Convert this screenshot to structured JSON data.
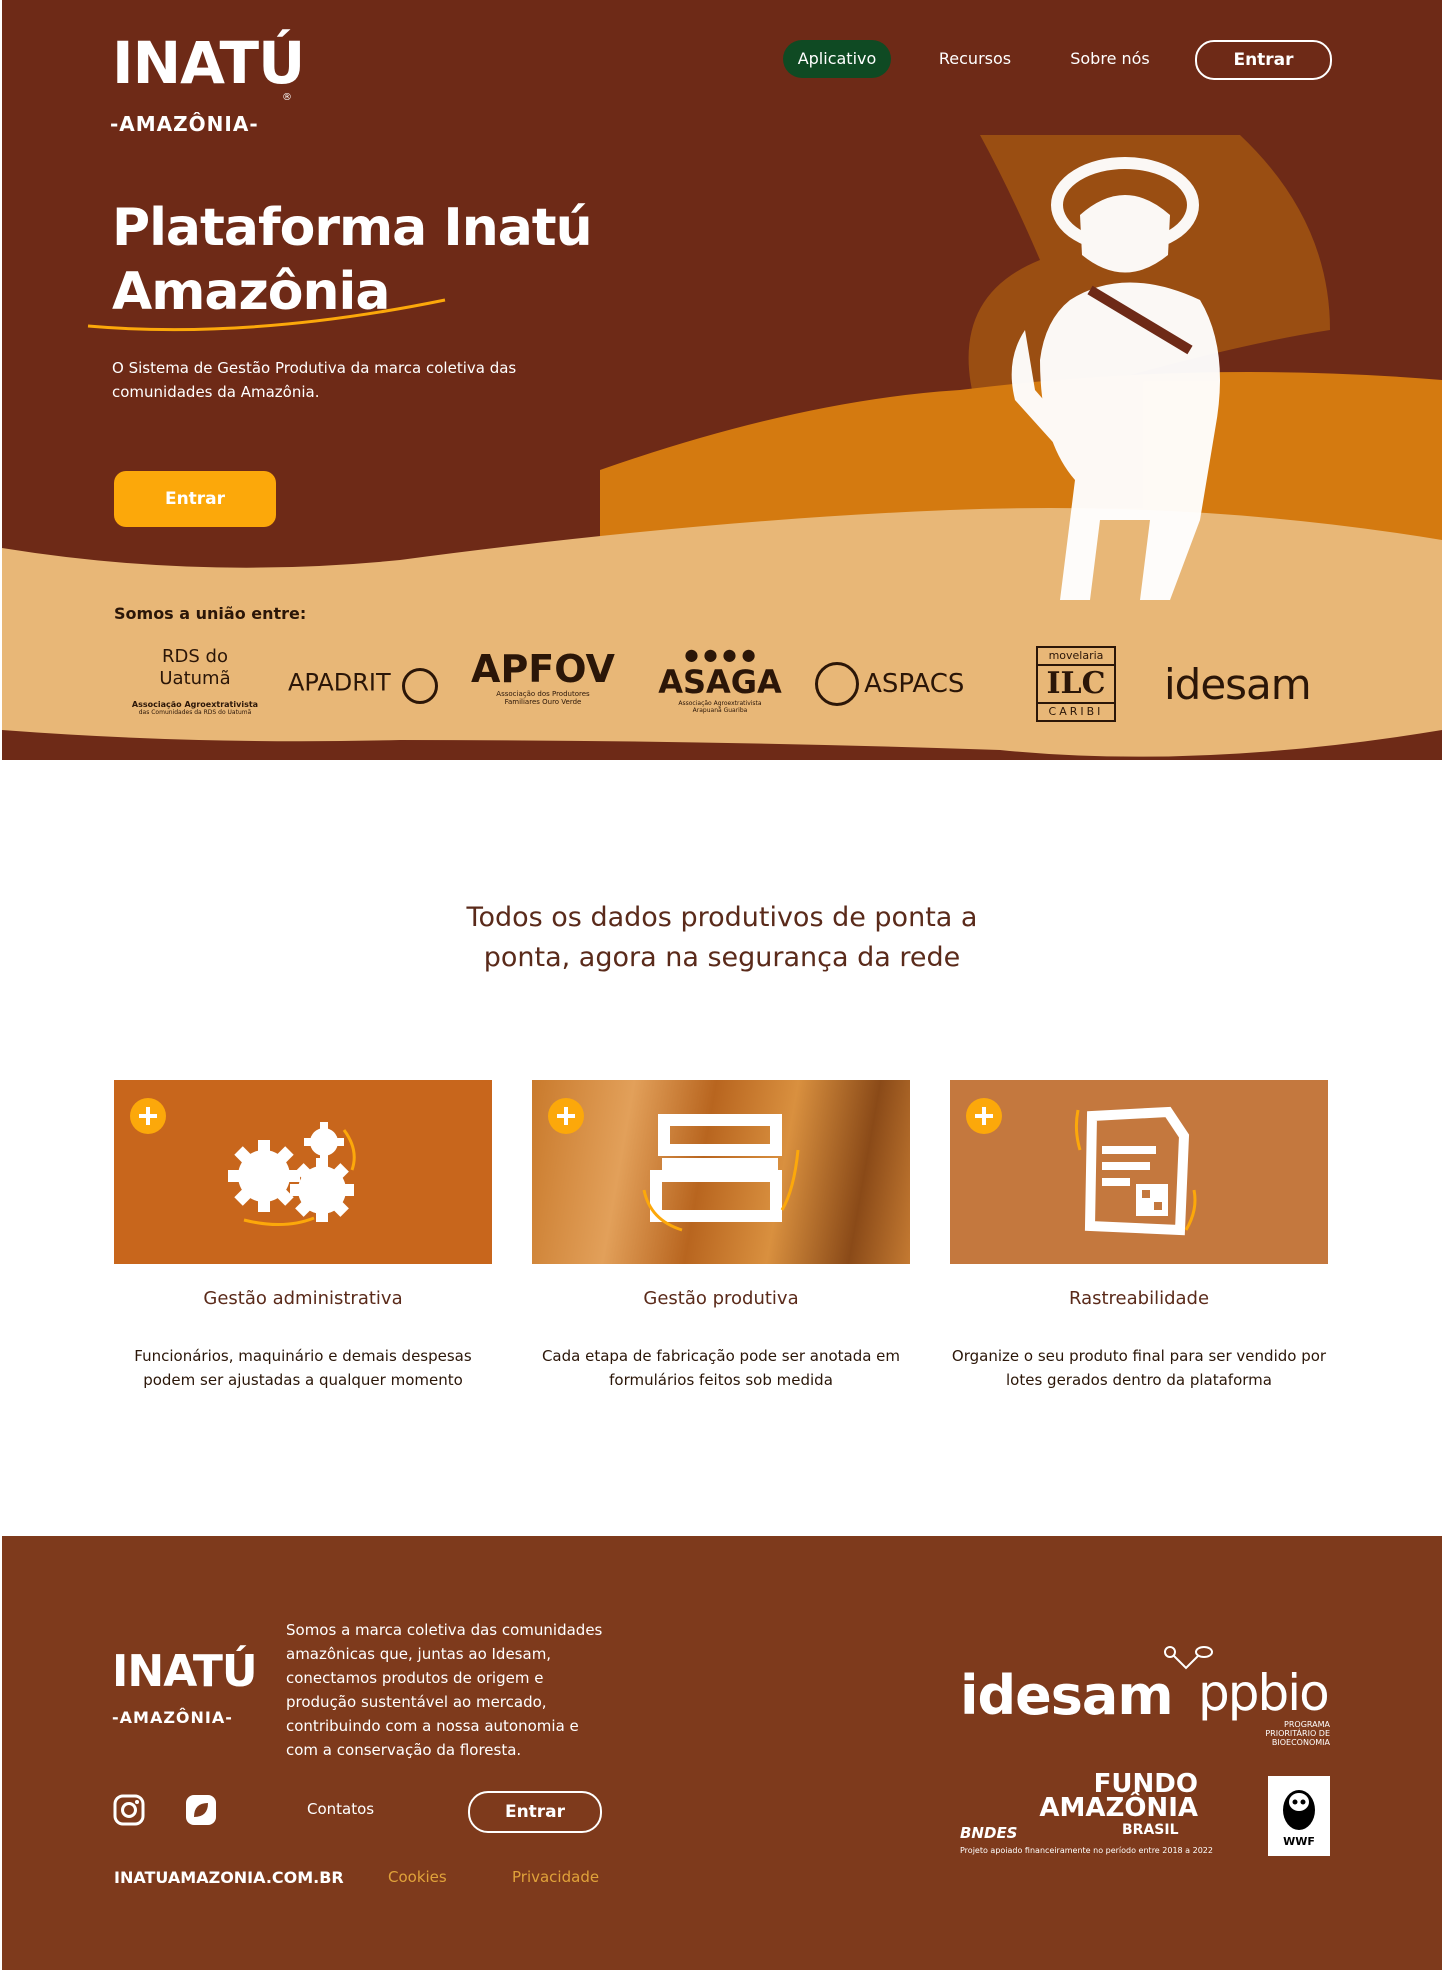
{
  "brand": {
    "logo_name": "INATÚ",
    "logo_sub": "-AMAZÔNIA-",
    "logo_reg": "®"
  },
  "nav": {
    "items": [
      "Aplicativo",
      "Recursos",
      "Sobre nós"
    ],
    "entrar": "Entrar"
  },
  "hero": {
    "title_line1": "Plataforma Inatú",
    "title_line2": "Amazônia",
    "description": "O Sistema de Gestão Produtiva da marca coletiva das comunidades da Amazônia.",
    "cta": "Entrar",
    "union_label": "Somos a união entre:"
  },
  "partners": [
    {
      "name": "RDS do Uatumã",
      "caption": "Associação Agroextrativista",
      "caption2": "das Comunidades da RDS do Uatumã"
    },
    {
      "name": "APADRIT"
    },
    {
      "name": "APFOV",
      "caption": "Associação dos Produtores",
      "caption2": "Familiares Ouro Verde"
    },
    {
      "name": "ASAGA",
      "caption": "Associação Agroextrativista",
      "caption2": "Arapuanã Guariba"
    },
    {
      "name": "ASPACS"
    },
    {
      "name": "ILC",
      "caption": "movelaria",
      "caption2": "CARIBI"
    },
    {
      "name": "idesam"
    }
  ],
  "section": {
    "title": "Todos os dados produtivos de ponta a ponta, agora na segurança da rede"
  },
  "cards": [
    {
      "title": "Gestão administrativa",
      "desc": "Funcionários, maquinário e demais despesas podem ser ajustadas a qualquer momento",
      "icon": "gears-icon"
    },
    {
      "title": "Gestão produtiva",
      "desc": "Cada etapa de fabricação pode ser anotada em formulários feitos sob medida",
      "icon": "forms-icon"
    },
    {
      "title": "Rastreabilidade",
      "desc": "Organize o seu produto final para ser vendido por lotes gerados dentro da plataforma",
      "icon": "qr-document-icon"
    }
  ],
  "footer": {
    "logo_name": "INATÚ",
    "logo_sub": "-AMAZÔNIA-",
    "description": "Somos a marca coletiva das comunidades amazônicas que, juntas ao Idesam, conectamos produtos de origem e produção sustentável ao mercado, contribuindo com a nossa autonomia e com a conservação da floresta.",
    "contatos": "Contatos",
    "entrar": "Entrar",
    "site": "INATUAMAZONIA.COM.BR",
    "cookies": "Cookies",
    "privacidade": "Privacidade",
    "sponsors": {
      "idesam": "idesam",
      "ppbio": "ppbio",
      "ppbio_sub": "PROGRAMA PRIORITÁRIO DE BIOECONOMIA",
      "fundo_line1": "FUNDO",
      "fundo_line2": "AMAZÔNIA",
      "bndes": "BNDES",
      "brasil": "BRASIL",
      "projeto": "Projeto apoiado financeiramente no período entre 2018 a 2022",
      "wwf": "WWF"
    }
  },
  "colors": {
    "hero_brown": "#6e2a17",
    "orange": "#d47a10",
    "sand": "#e8b777",
    "accent_yellow": "#fca80a",
    "nav_green": "#0f4a23",
    "footer_brown": "#7e3a1c",
    "heading_brown": "#5a2a1a"
  }
}
